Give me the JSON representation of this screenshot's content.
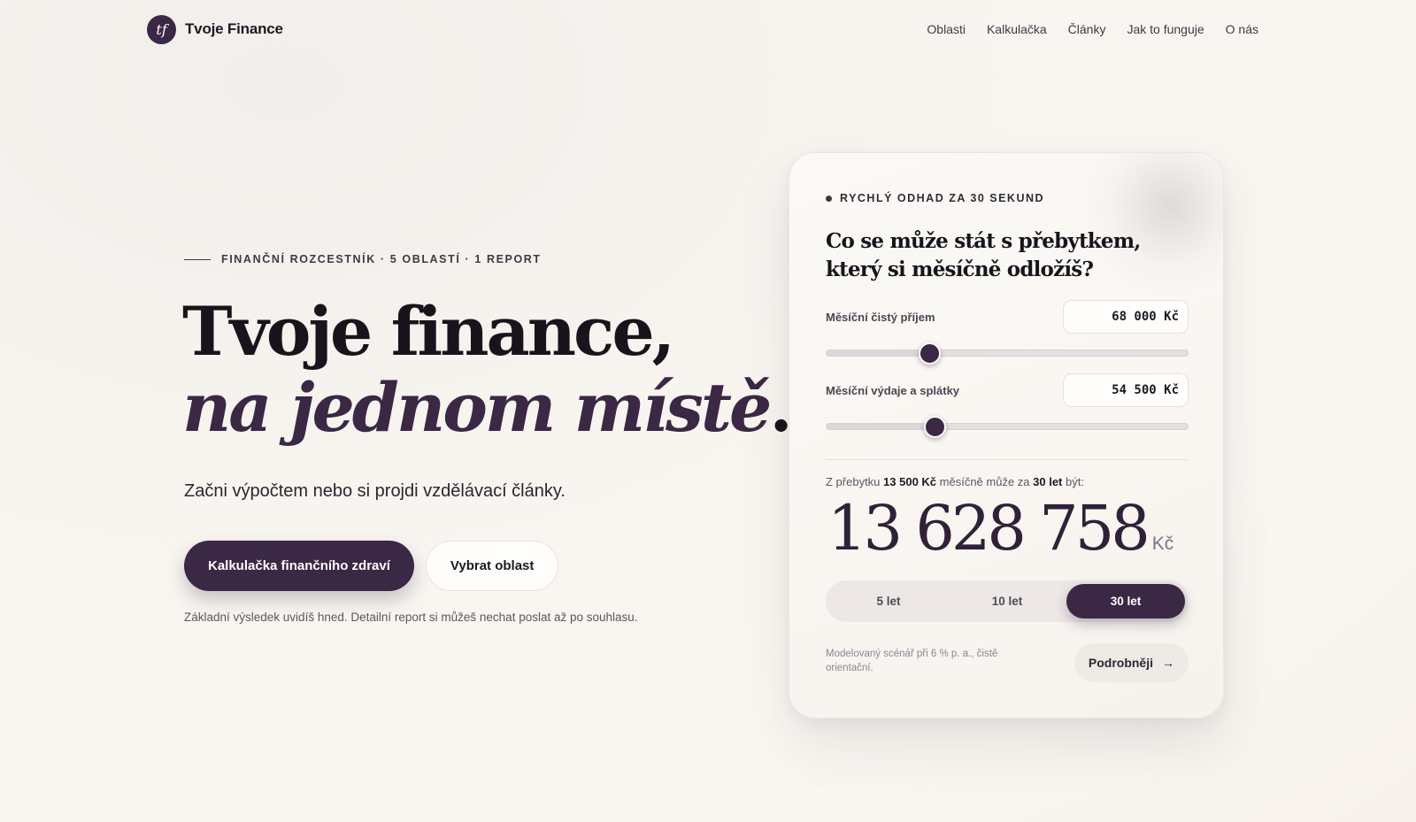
{
  "header": {
    "logo_text": "tf",
    "brand": "Tvoje Finance",
    "nav": [
      "Oblasti",
      "Kalkulačka",
      "Články",
      "Jak to funguje",
      "O nás"
    ]
  },
  "hero": {
    "eyebrow": "FINANČNÍ ROZCESTNÍK · 5 OBLASTÍ · 1 REPORT",
    "title_line1": "Tvoje finance,",
    "title_line2": "na jednom místě",
    "title_dot": ".",
    "lead": "Začni výpočtem nebo si projdi vzdělávací články.",
    "primary_button": "Kalkulačka finančního zdraví",
    "secondary_button": "Vybrat oblast",
    "note": "Základní výsledek uvidíš hned. Detailní report si můžeš nechat poslat až po souhlasu."
  },
  "card": {
    "kicker": "RYCHLÝ ODHAD ZA 30 SEKUND",
    "title": "Co se může stát s přebytkem, který si měsíčně odložíš?",
    "income": {
      "label": "Měsíční čistý příjem",
      "value": "68 000 Kč",
      "slider_fraction": 0.285
    },
    "expenses": {
      "label": "Měsíční výdaje a splátky",
      "value": "54 500 Kč",
      "slider_fraction": 0.298
    },
    "summary": {
      "prefix": "Z přebytku ",
      "surplus": "13 500 Kč",
      "middle": " měsíčně může za ",
      "years": "30 let",
      "suffix": " být:"
    },
    "result_value": "13 628 758",
    "result_unit": "Kč",
    "periods": [
      {
        "label": "5 let",
        "active": false
      },
      {
        "label": "10 let",
        "active": false
      },
      {
        "label": "30 let",
        "active": true
      }
    ],
    "disclaimer": "Modelovaný scénář při 6 % p. a., čistě orientační.",
    "more_button": "Podrobněji",
    "more_icon": "arrow-right-icon"
  },
  "colors": {
    "accent": "#3a2845",
    "background": "#faf7f2",
    "text": "#1d1a22"
  }
}
